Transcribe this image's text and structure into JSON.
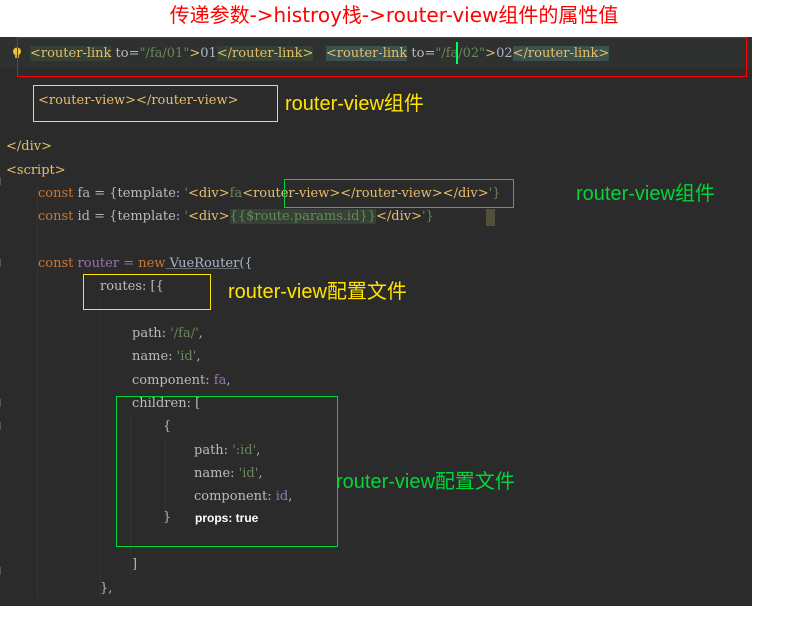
{
  "title": "传递参数->histroy栈->router-view组件的属性值",
  "line1": {
    "link1_open": "<router-link",
    "link1_attr": " to=",
    "link1_val": "\"/fa/01\"",
    "link1_gt": ">",
    "link1_text": "01",
    "link1_close": "</router-link>",
    "link2_open_a": "<router",
    "link2_open_b": "-link",
    "link2_attr": " to=",
    "link2_val": "\"/fa/02\"",
    "link2_gt": ">",
    "link2_text": "02",
    "link2_close": "</router-link>"
  },
  "line_rv": "<router-view></router-view>",
  "close_div": "</div>",
  "script_tag": "<script>",
  "fa_line": {
    "kw": "const",
    "name": " fa = {",
    "key": "template",
    "colon": ": ",
    "q": "'",
    "div_open": "<div>",
    "fa": "fa",
    "rv": "<router-view></router-view>",
    "div_close": "</div>",
    "end": "'}"
  },
  "id_line": {
    "kw": "const",
    "name": " id = {",
    "key": "template",
    "colon": ": ",
    "q": "'",
    "div_open": "<div>",
    "expr": "{{$route.params.id}}",
    "div_close": "</div>",
    "end": "'}"
  },
  "router_line": {
    "kw": "const",
    "name": " router = ",
    "new": "new",
    "cls": " VueRouter",
    "paren": "({"
  },
  "routes_line": "routes: [{",
  "path_line": {
    "key": "path",
    "val": "'/fa/'"
  },
  "name_line": {
    "key": "name",
    "val": "'id'"
  },
  "component_line": {
    "key": "component",
    "val": "fa"
  },
  "children_line": "children: [",
  "brace_open": "{",
  "child_path": {
    "key": "path",
    "val": "':id'"
  },
  "child_name": {
    "key": "name",
    "val": "'id'"
  },
  "child_component": {
    "key": "component",
    "val": "id"
  },
  "brace_close": "}",
  "props_text": "props: true",
  "bracket_close": "]",
  "routes_close": "},",
  "annotations": {
    "rv_component_1": "router-view组件",
    "rv_component_2": "router-view组件",
    "rv_config_1": "router-view配置文件",
    "rv_config_2": "router-view配置文件"
  },
  "colors": {
    "red": "#ff0000",
    "yellow": "#ffe400",
    "green": "#00d637",
    "editor_bg": "#2b2b2b"
  },
  "icons": {
    "bulb": "lightbulb-icon"
  }
}
